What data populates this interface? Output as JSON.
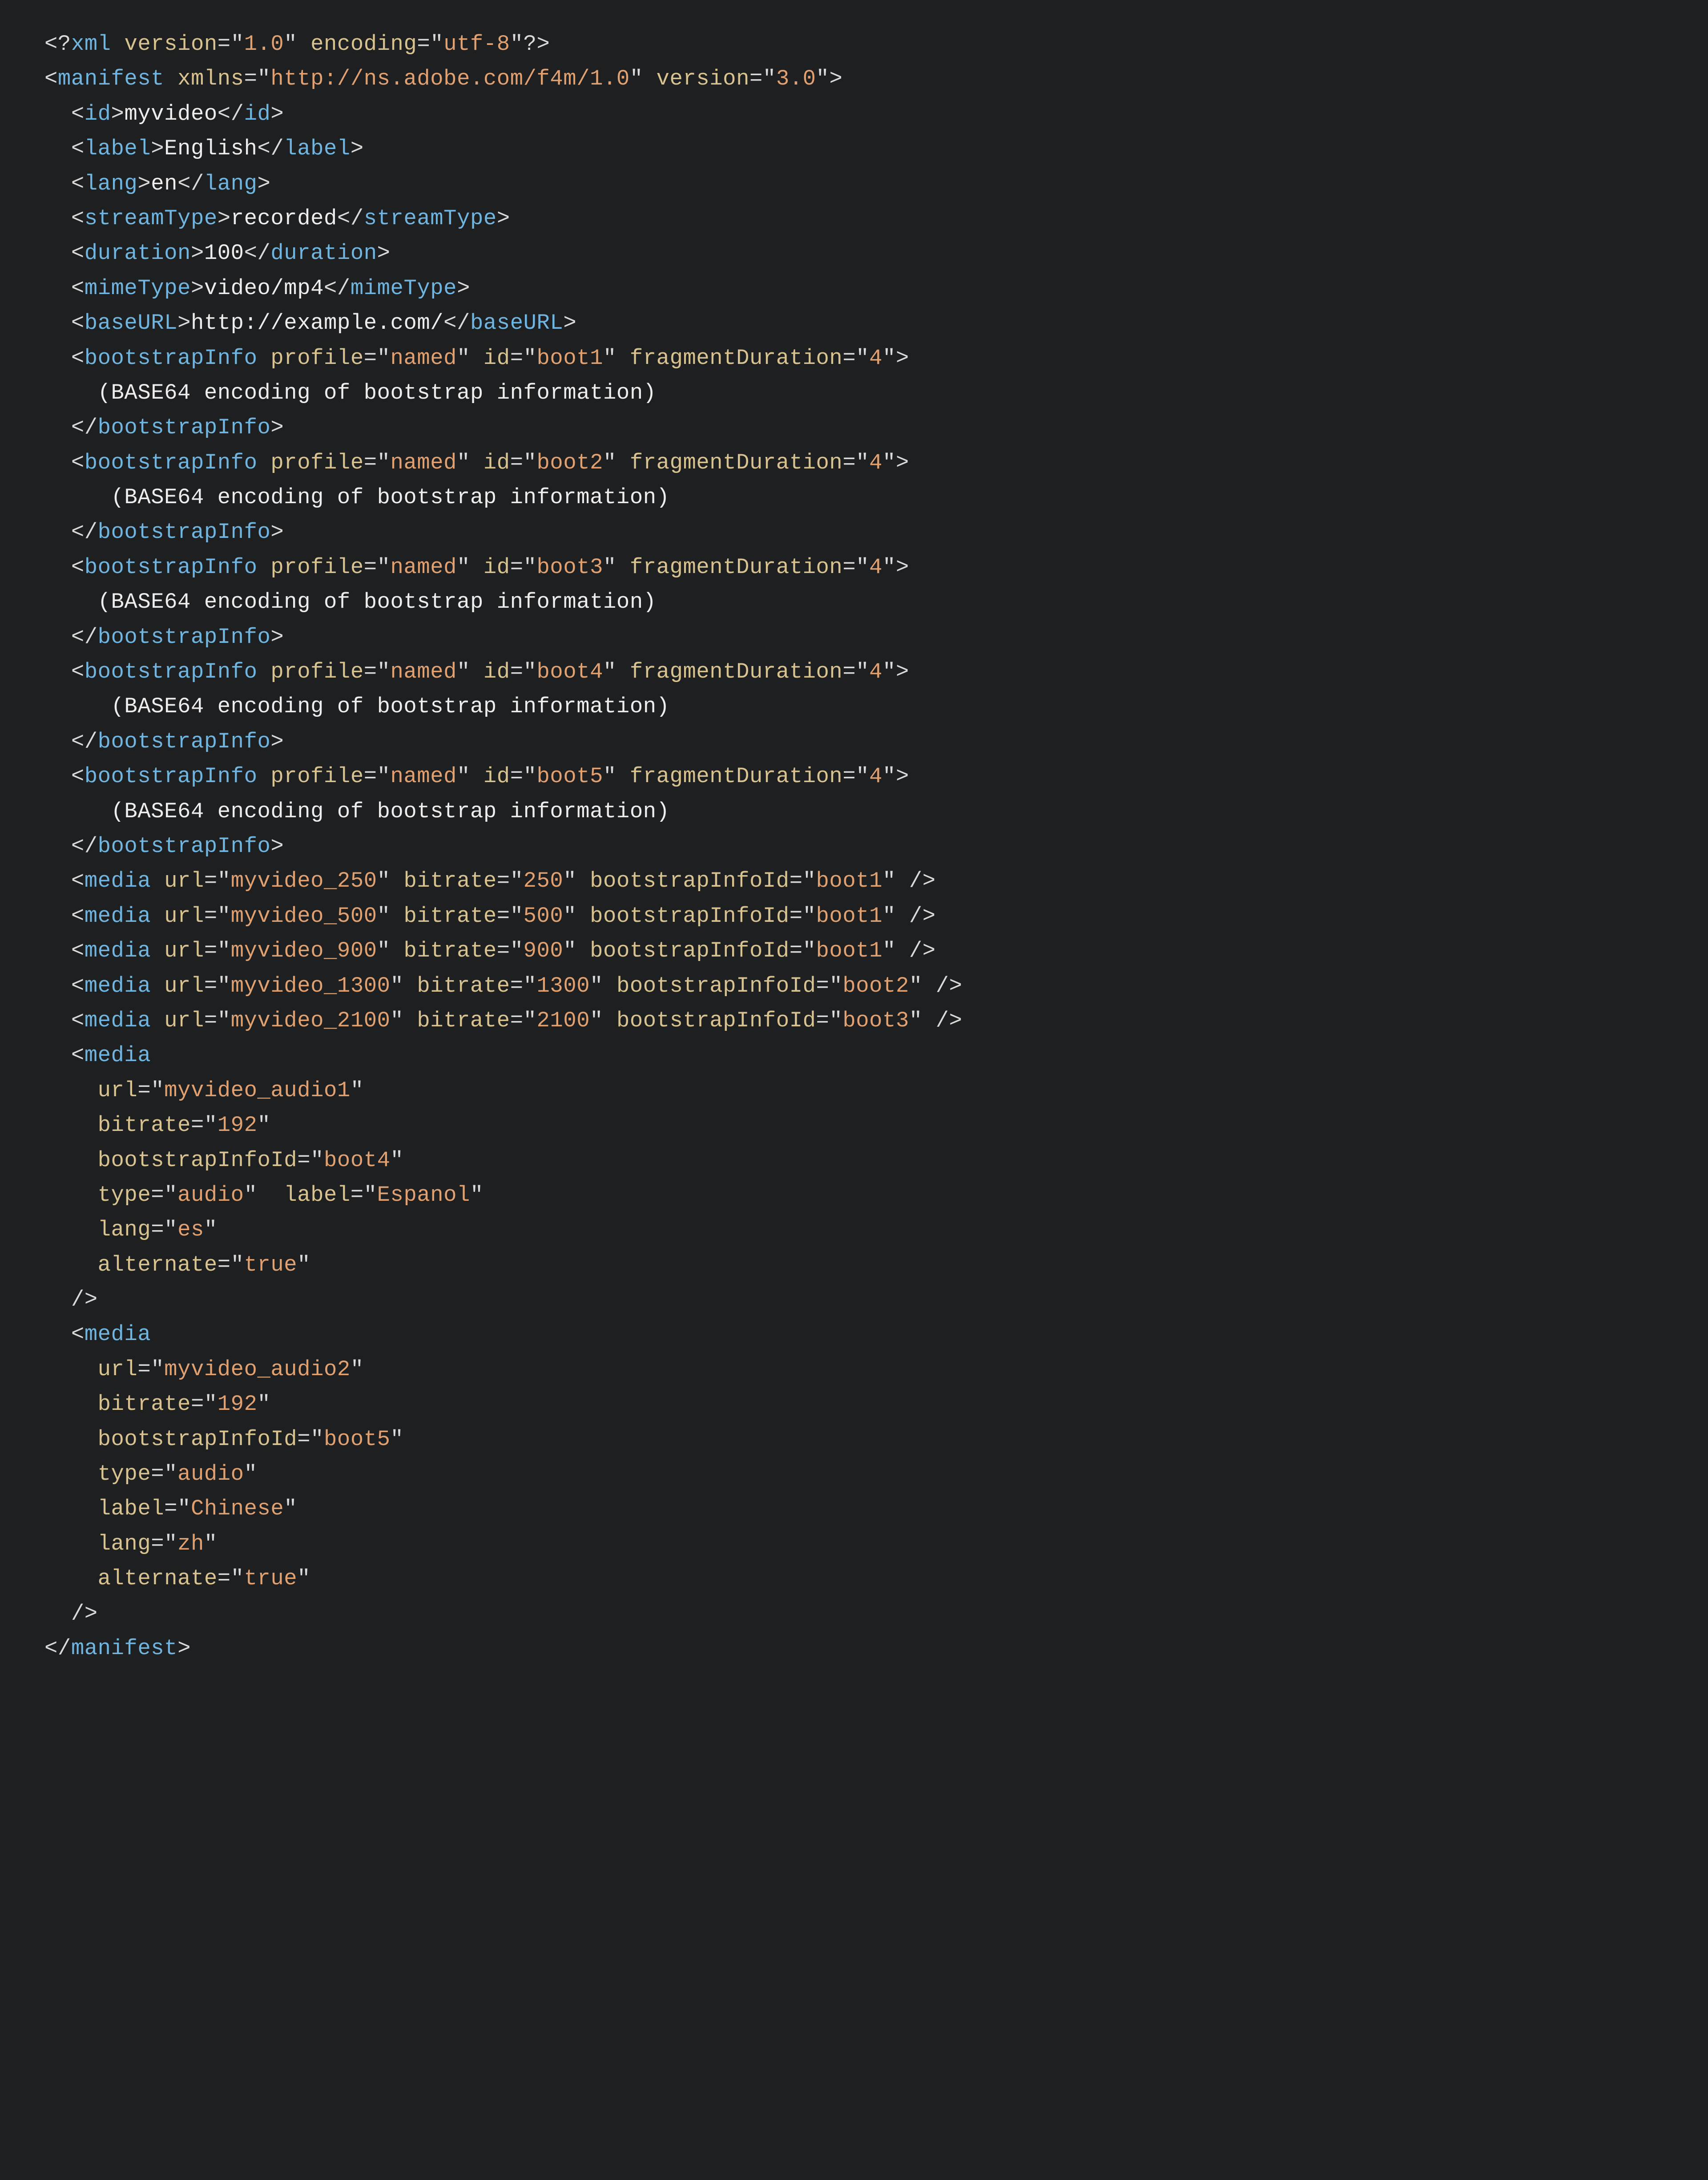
{
  "xml": {
    "declaration": {
      "version": "1.0",
      "encoding": "utf-8"
    },
    "root": {
      "name": "manifest",
      "attrs": {
        "xmlns": "http://ns.adobe.com/f4m/1.0",
        "version": "3.0"
      }
    },
    "simple": {
      "id": "myvideo",
      "label": "English",
      "lang": "en",
      "streamType": "recorded",
      "duration": "100",
      "mimeType": "video/mp4",
      "baseURL": "http://example.com/"
    },
    "bootstraps": [
      {
        "profile": "named",
        "id": "boot1",
        "fragmentDuration": "4",
        "content": "(BASE64 encoding of bootstrap information)",
        "indent": "    "
      },
      {
        "profile": "named",
        "id": "boot2",
        "fragmentDuration": "4",
        "content": "(BASE64 encoding of bootstrap information)",
        "indent": "     "
      },
      {
        "profile": "named",
        "id": "boot3",
        "fragmentDuration": "4",
        "content": "(BASE64 encoding of bootstrap information)",
        "indent": "    "
      },
      {
        "profile": "named",
        "id": "boot4",
        "fragmentDuration": "4",
        "content": "(BASE64 encoding of bootstrap information)",
        "indent": "     "
      },
      {
        "profile": "named",
        "id": "boot5",
        "fragmentDuration": "4",
        "content": "(BASE64 encoding of bootstrap information)",
        "indent": "     "
      }
    ],
    "mediaShort": [
      {
        "url": "myvideo_250",
        "bitrate": "250",
        "bootstrapInfoId": "boot1"
      },
      {
        "url": "myvideo_500",
        "bitrate": "500",
        "bootstrapInfoId": "boot1"
      },
      {
        "url": "myvideo_900",
        "bitrate": "900",
        "bootstrapInfoId": "boot1"
      },
      {
        "url": "myvideo_1300",
        "bitrate": "1300",
        "bootstrapInfoId": "boot2"
      },
      {
        "url": "myvideo_2100",
        "bitrate": "2100",
        "bootstrapInfoId": "boot3"
      }
    ],
    "mediaLong": [
      {
        "url": "myvideo_audio1",
        "bitrate": "192",
        "bootstrapInfoId": "boot4",
        "typeLabelLine": {
          "type": "audio",
          "label": "Espanol"
        },
        "lang": "es",
        "alternate": "true"
      },
      {
        "url": "myvideo_audio2",
        "bitrate": "192",
        "bootstrapInfoId": "boot5",
        "type": "audio",
        "label": "Chinese",
        "lang": "zh",
        "alternate": "true"
      }
    ]
  }
}
